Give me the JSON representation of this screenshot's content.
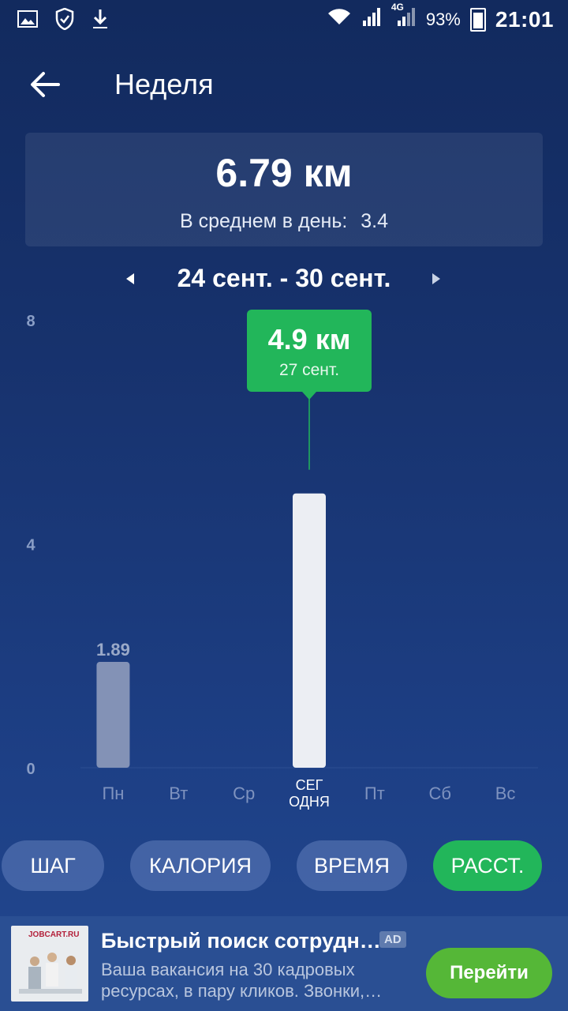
{
  "status": {
    "battery": "93%",
    "time": "21:01",
    "network": "4G"
  },
  "header": {
    "title": "Неделя"
  },
  "summary": {
    "total": "6.79 км",
    "avg_label": "В среднем в день:",
    "avg_value": "3.4"
  },
  "range": {
    "label": "24 сент. - 30 сент."
  },
  "chart_data": {
    "type": "bar",
    "categories": [
      "Пн",
      "Вт",
      "Ср",
      "СЕГ ОДНЯ",
      "Пт",
      "Сб",
      "Вс"
    ],
    "values": [
      1.89,
      0,
      0,
      4.9,
      0,
      0,
      0
    ],
    "y_ticks": [
      "8",
      "4",
      "0"
    ],
    "ylim": [
      0,
      8
    ],
    "data_labels": [
      "1.89"
    ],
    "tooltip": {
      "value": "4.9 км",
      "date": "27 сент."
    },
    "colors": {
      "bar": "#8392b6",
      "selected_bar": "#eceef3",
      "tooltip": "#22b65a"
    }
  },
  "metrics": {
    "items": [
      {
        "label": "ШАГ"
      },
      {
        "label": "КАЛОРИЯ"
      },
      {
        "label": "ВРЕМЯ"
      },
      {
        "label": "РАССТ."
      }
    ]
  },
  "ad": {
    "brand": "JOBCART.RU",
    "title": "Быстрый поиск сотрудн…",
    "badge": "AD",
    "description": "Ваша вакансия на 30 кадровых ресурсах, в пару кликов. Звонки,…",
    "button": "Перейти"
  }
}
